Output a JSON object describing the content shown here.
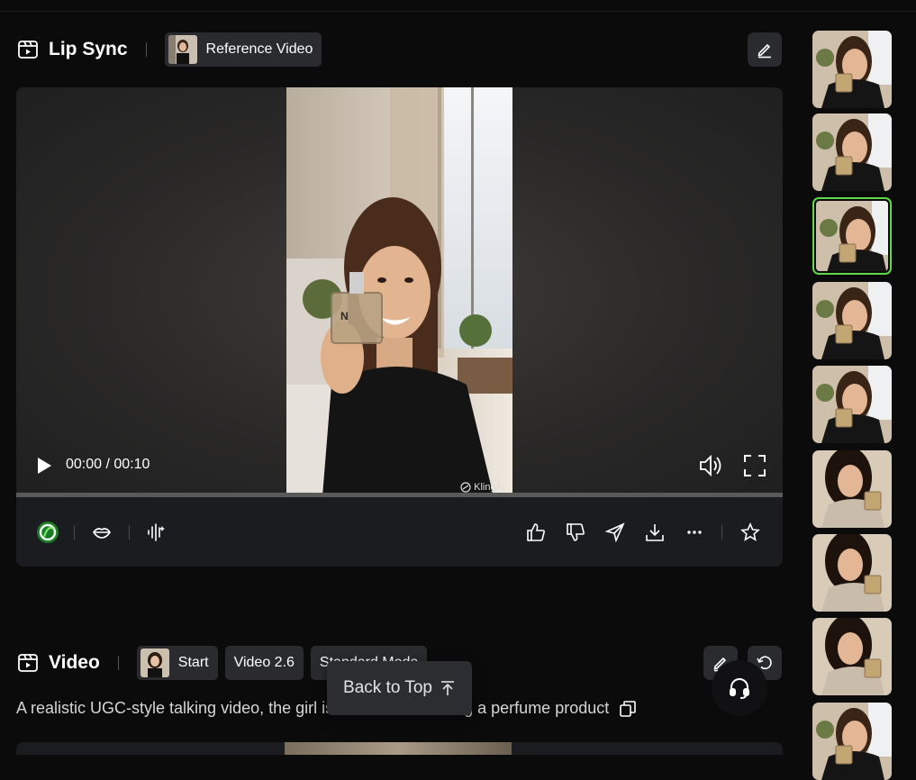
{
  "lipsync": {
    "title": "Lip Sync",
    "reference_chip": "Reference Video",
    "edit_icon": "edit-icon"
  },
  "player": {
    "time": "00:00 / 00:10",
    "watermark": "KlingAI",
    "progress": 0
  },
  "toolbar": {
    "icons": [
      "model-logo-icon",
      "lips-icon",
      "audio-wave-icon",
      "thumbs-up-icon",
      "thumbs-down-icon",
      "send-icon",
      "download-icon",
      "more-icon",
      "star-icon"
    ]
  },
  "video": {
    "title": "Video",
    "start_chip": "Start",
    "model_chip": "Video 2.6",
    "mode_chip": "Standard Mode",
    "prompt": "A realistic UGC-style talking video, the girl is",
    "prompt_tail": "g a perfume product"
  },
  "back_to_top": "Back to Top",
  "sidebar": {
    "active_index": 2,
    "count": 9
  },
  "colors": {
    "accent": "#5fd84a",
    "background": "#0b0b0c",
    "panel": "#1b1c1f",
    "chip": "#2a2b2e"
  }
}
